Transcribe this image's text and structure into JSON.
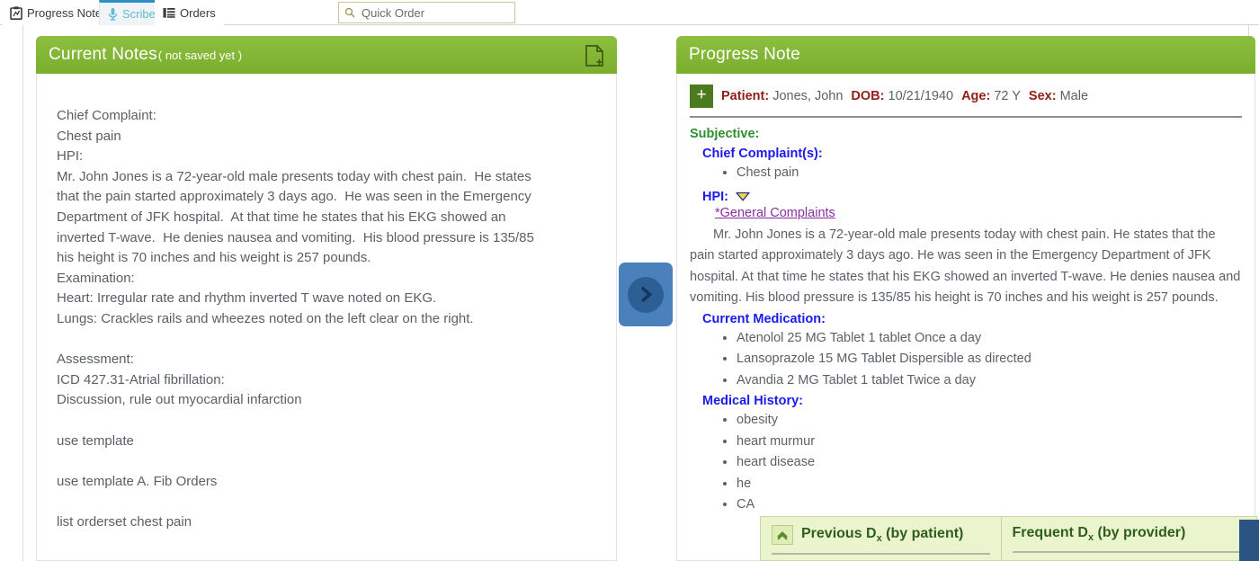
{
  "tabs": [
    {
      "label": "Progress Notes",
      "icon": "clipboard-note-icon",
      "active": false
    },
    {
      "label": "Scribe",
      "icon": "microphone-icon",
      "active": true
    },
    {
      "label": "Orders",
      "icon": "list-lines-icon",
      "active": false
    }
  ],
  "search": {
    "placeholder": "Quick Order",
    "value": "",
    "icon": "search-icon"
  },
  "left_panel": {
    "title": "Current Notes",
    "subtitle": "( not saved yet )",
    "new_document_icon": "new-document-icon",
    "note_text": "Chief Complaint:\nChest pain\nHPI:\nMr. John Jones is a 72-year-old male presents today with chest pain.  He states\nthat the pain started approximately 3 days ago.  He was seen in the Emergency\nDepartment of JFK hospital.  At that time he states that his EKG showed an\ninverted T-wave.  He denies nausea and vomiting.  His blood pressure is 135/85\nhis height is 70 inches and his weight is 257 pounds.\nExamination:\nHeart: Irregular rate and rhythm inverted T wave noted on EKG.\nLungs: Crackles rails and wheezes noted on the left clear on the right.\n\nAssessment:\nICD 427.31-Atrial fibrillation:\nDiscussion, rule out myocardial infarction\n\nuse template\n\nuse template A. Fib Orders\n\nlist orderset chest pain"
  },
  "transfer_button": {
    "icon": "chevron-right-icon",
    "color": "#4a81bd"
  },
  "right_panel": {
    "title": "Progress Note",
    "add_button_label": "+",
    "patient": [
      {
        "label": "Patient:",
        "value": "Jones, John"
      },
      {
        "label": "DOB:",
        "value": "10/21/1940"
      },
      {
        "label": "Age:",
        "value": "72 Y"
      },
      {
        "label": "Sex:",
        "value": "Male"
      }
    ],
    "subjective_heading": "Subjective:",
    "chief_complaint_heading": "Chief Complaint(s):",
    "chief_complaints": [
      "Chest pain"
    ],
    "hpi_heading": "HPI:",
    "hpi_toggle_icon": "triangle-down-icon",
    "hpi_link": "*General Complaints",
    "hpi_paragraph": "Mr. John Jones is a 72-year-old male presents today with chest pain. He states that the pain started approximately 3 days ago. He was seen in the Emergency Department of JFK hospital. At that time he states that his EKG showed an inverted T-wave. He denies nausea and vomiting. His blood pressure is 135/85 his height is 70 inches and his weight is 257 pounds.",
    "current_medication_heading": "Current Medication:",
    "current_medication": [
      "Atenolol 25 MG Tablet 1 tablet Once a day",
      "Lansoprazole 15 MG Tablet Dispersible as directed",
      "Avandia 2 MG Tablet 1 tablet Twice a day"
    ],
    "medical_history_heading": "Medical History:",
    "medical_history": [
      "obesity",
      "heart murmur",
      "heart disease",
      "he",
      "CA"
    ]
  },
  "dx_popup": {
    "collapse_icon": "chevron-up-icon",
    "previous_title_main": "Previous D",
    "previous_title_sub": "x",
    "previous_title_tail": " (by patient)",
    "frequent_title_main": "Frequent D",
    "frequent_title_sub": "x",
    "frequent_title_tail": " (by provider)"
  },
  "colors": {
    "header_green": "#7cae2e",
    "subjective_green": "#2f8f2f",
    "section_blue": "#1a1aee",
    "link_purple": "#8b2fa0",
    "patient_label_red": "#8f1f18",
    "transfer_blue": "#4a81bd",
    "popup_bg": "#ebf5cd"
  }
}
